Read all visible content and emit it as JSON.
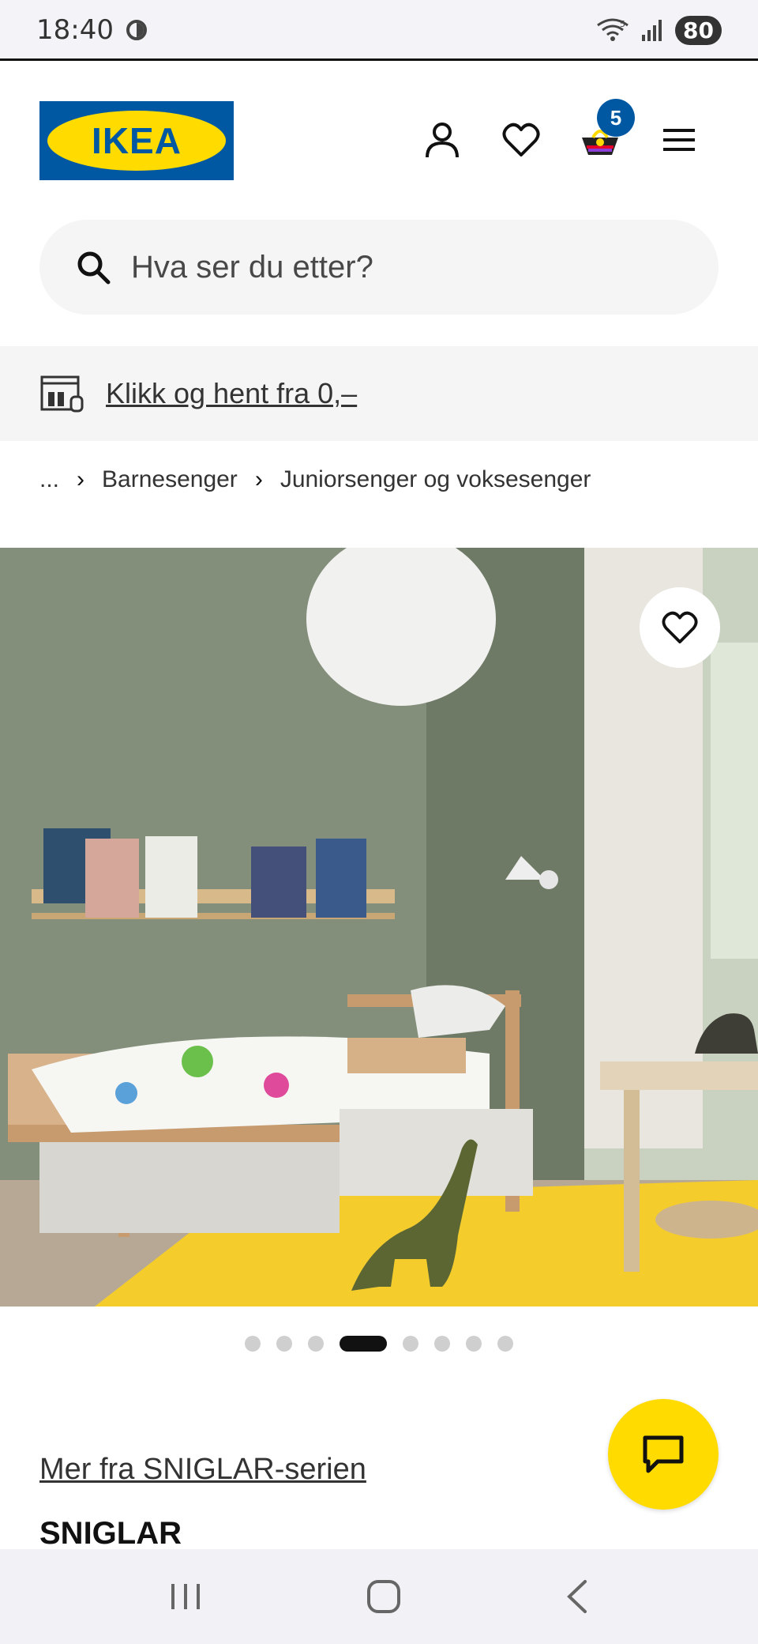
{
  "status_bar": {
    "time": "18:40",
    "battery": "80",
    "network": "5"
  },
  "header": {
    "logo_text": "IKEA",
    "cart_count": "5"
  },
  "search": {
    "placeholder": "Hva ser du etter?"
  },
  "promo": {
    "text": "Klikk og hent fra 0,–"
  },
  "breadcrumb": {
    "items": [
      "...",
      "Barnesenger",
      "Juniorsenger og voksesenger"
    ]
  },
  "carousel": {
    "total": 8,
    "active_index": 3
  },
  "product": {
    "series_link": "Mer fra SNIGLAR-serien",
    "name": "SNIGLAR"
  },
  "colors": {
    "brand_blue": "#0058a3",
    "brand_yellow": "#ffdb00"
  }
}
